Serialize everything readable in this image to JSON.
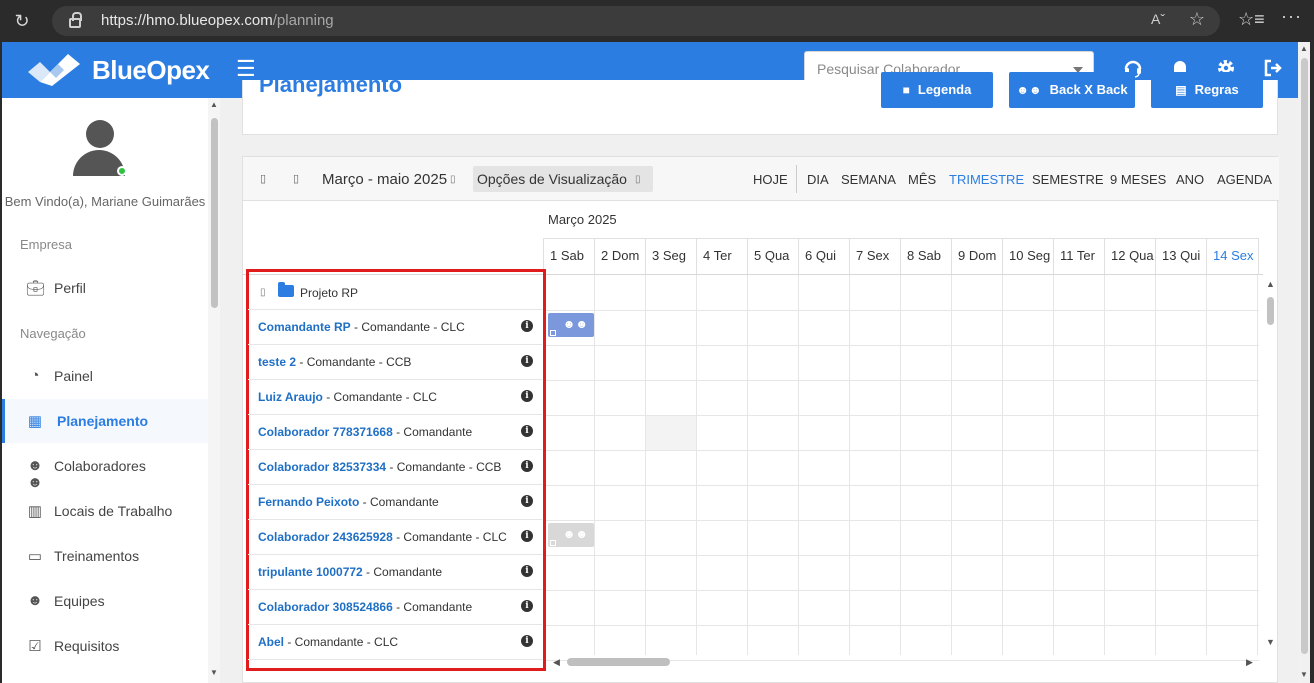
{
  "browser": {
    "url_host": "https://hmo.blueopex.com",
    "url_path": "/planning",
    "reader_icon": "Aˇ",
    "favorites_icon": "star-icon"
  },
  "app": {
    "logo_text": "BlueOpex",
    "search_placeholder": "Pesquisar Colaborador",
    "brand_color": "#2b7de1"
  },
  "sidebar": {
    "welcome": "Bem Vindo(a), Mariane Guimarães",
    "section_empresa": "Empresa",
    "section_navegacao": "Navegação",
    "items": [
      {
        "label": "Perfil",
        "icon": "briefcase-icon"
      },
      {
        "label": "Painel",
        "icon": "dashboard-icon"
      },
      {
        "label": "Planejamento",
        "icon": "calendar-icon"
      },
      {
        "label": "Colaboradores",
        "icon": "users-icon"
      },
      {
        "label": "Locais de Trabalho",
        "icon": "building-icon"
      },
      {
        "label": "Treinamentos",
        "icon": "training-icon"
      },
      {
        "label": "Equipes",
        "icon": "team-icon"
      },
      {
        "label": "Requisitos",
        "icon": "checkbox-icon"
      }
    ]
  },
  "header": {
    "title": "Planejamento",
    "buttons": {
      "legend": "Legenda",
      "back_x_back": "Back X Back",
      "rules": "Regras"
    }
  },
  "planner": {
    "period": "Março - maio 2025",
    "view_options": "Opções de Visualização",
    "today": "HOJE",
    "ranges": [
      "DIA",
      "SEMANA",
      "MÊS",
      "TRIMESTRE",
      "SEMESTRE",
      "9 MESES",
      "ANO",
      "AGENDA"
    ],
    "active_range": "TRIMESTRE",
    "month_label": "Março 2025",
    "days": [
      "1  Sab",
      "2  Dom",
      "3  Seg",
      "4  Ter",
      "5  Qua",
      "6  Qui",
      "7  Sex",
      "8  Sab",
      "9  Dom",
      "10  Seg",
      "11  Ter",
      "12  Qua",
      "13  Qui",
      "14  Sex"
    ],
    "project": "Projeto RP",
    "resources": [
      {
        "name": "Comandante RP",
        "role": " - Comandante - CLC"
      },
      {
        "name": "teste 2",
        "role": " - Comandante - CCB"
      },
      {
        "name": "Luiz Araujo",
        "role": " - Comandante - CLC"
      },
      {
        "name": "Colaborador 778371668",
        "role": " - Comandante"
      },
      {
        "name": "Colaborador 82537334",
        "role": " - Comandante - CCB"
      },
      {
        "name": "Fernando Peixoto",
        "role": " - Comandante"
      },
      {
        "name": "Colaborador 243625928",
        "role": " - Comandante - CLC"
      },
      {
        "name": "tripulante 1000772",
        "role": " - Comandante"
      },
      {
        "name": "Colaborador 308524866",
        "role": " - Comandante"
      },
      {
        "name": "Abel",
        "role": " - Comandante - CLC"
      }
    ],
    "info_glyph": "i"
  }
}
